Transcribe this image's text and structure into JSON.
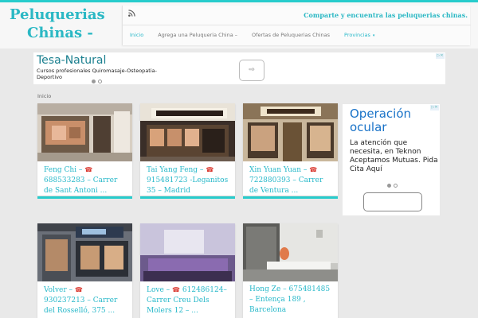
{
  "site": {
    "title_line1": "Peluquerias",
    "title_line2": "Chinas -",
    "tagline": "Comparte y encuentra las peluquerias chinas.",
    "rss_icon": "rss-icon"
  },
  "menu": {
    "items": [
      {
        "label": "Inicio",
        "active": true
      },
      {
        "label": "Agrega una Peluqueria China –"
      },
      {
        "label": "Ofertas de Peluquerias Chinas"
      },
      {
        "label": "Provincias",
        "dropdown": true
      }
    ],
    "caret": "▾"
  },
  "ad_top": {
    "title": "Tesa-Natural",
    "description": "Cursos profesionales Quiromasaje-Osteopatia-Deportivo",
    "button_glyph": "⇨",
    "adchoices": "▷✕"
  },
  "breadcrumb": "Inicio",
  "cards": [
    {
      "name": "Feng Chi –",
      "phone": "☎",
      "rest": "688533283 – Carrer de Sant Antoni ..."
    },
    {
      "name": "Tai Yang Feng –",
      "phone": "☎",
      "rest": "915481723 -Leganitos 35 – Madrid"
    },
    {
      "name": "Xin Yuan Yuan –",
      "phone": "☎",
      "rest": "722880393 – Carrer de Ventura ..."
    },
    {
      "name": "Volver –",
      "phone": "☎",
      "rest": "930237213 – Carrer del Rosselló, 375 ..."
    },
    {
      "name": "Love –",
      "phone": "☎",
      "rest": "612486124– Carrer Creu Dels Molers 12 – ..."
    },
    {
      "name": "Hong Ze –",
      "phone": "",
      "rest": "675481485 – Entença 189 , Barcelona"
    }
  ],
  "ad_side": {
    "title": "Operación ocular",
    "description": "La atención que necesita, en Teknon Aceptamos Mutuas. Pida Cita Aquí",
    "adchoices": "▷✕"
  },
  "colors": {
    "accent": "#27cccc",
    "link": "#27b8c9",
    "phone": "#d9342b"
  }
}
